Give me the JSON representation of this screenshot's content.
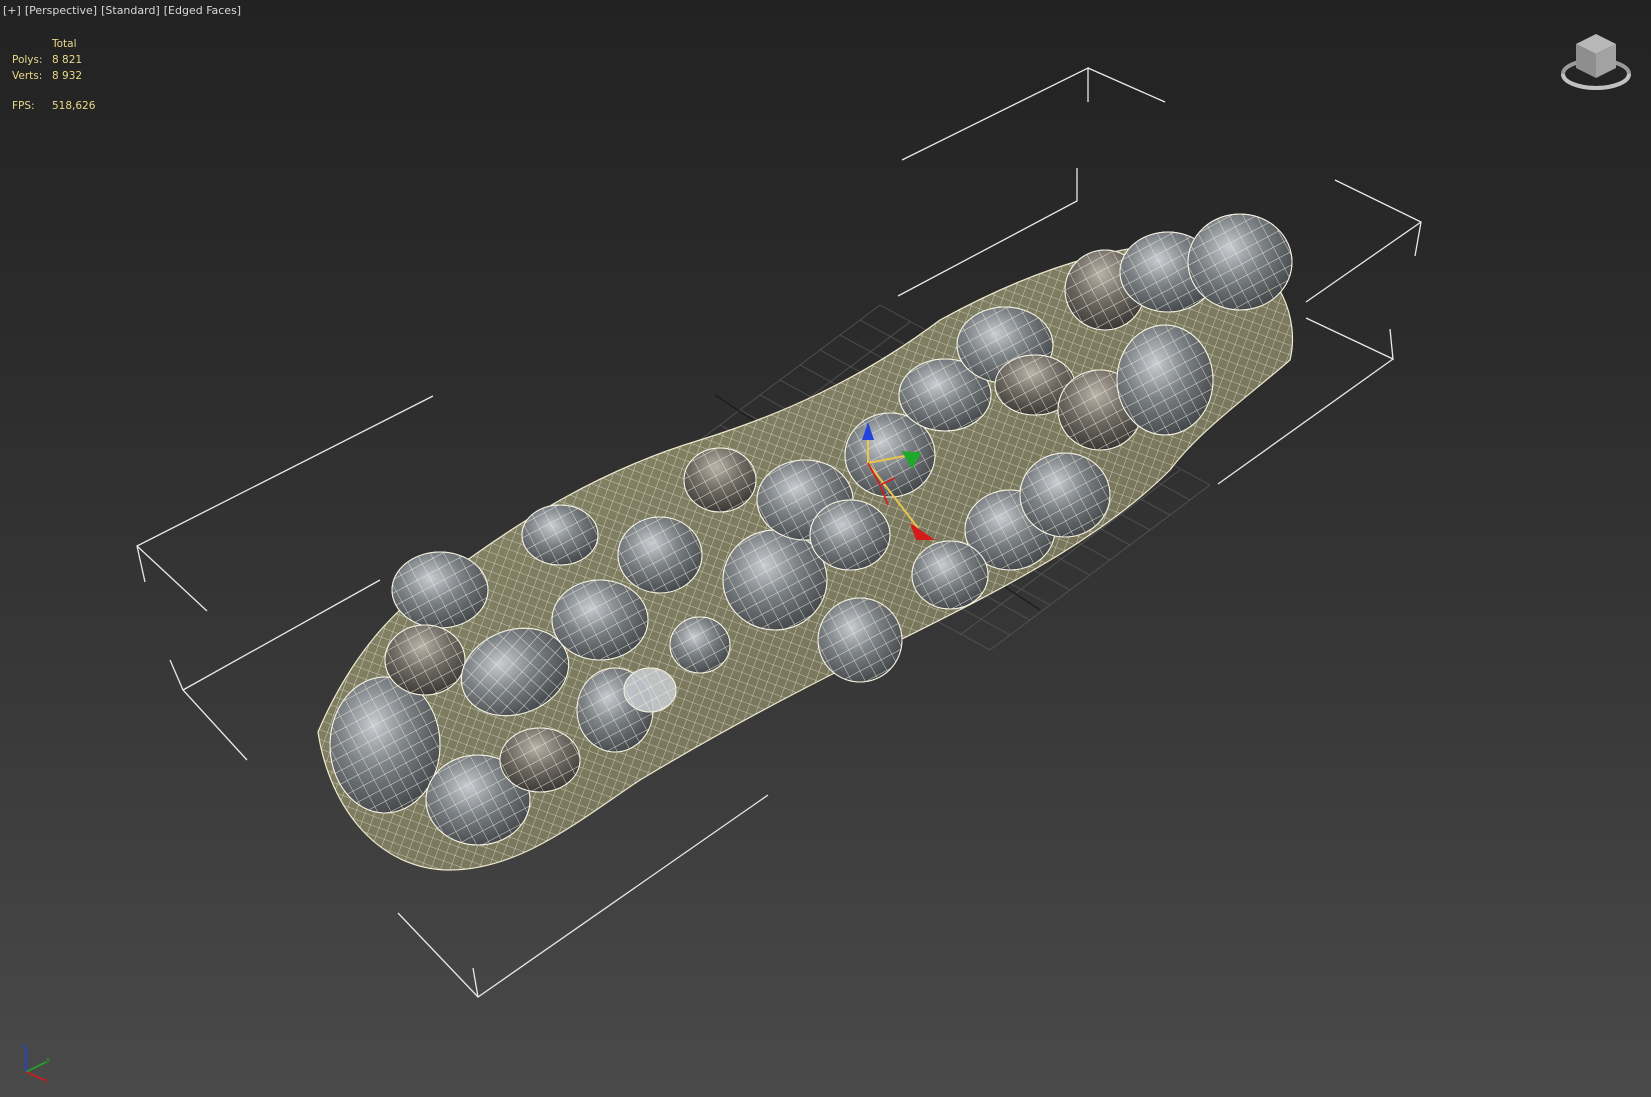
{
  "viewport": {
    "menu": {
      "plus": "[+]",
      "view": "[Perspective]",
      "shading": "[Standard]",
      "mode": "[Edged Faces]"
    },
    "stats": {
      "header": "Total",
      "polys_label": "Polys:",
      "polys_value": "8 821",
      "verts_label": "Verts:",
      "verts_value": "8 932",
      "fps_label": "FPS:",
      "fps_value": "518,626"
    },
    "icons": {
      "viewcube": "viewcube-icon",
      "gizmo": "move-gizmo-icon",
      "tripod": "axis-tripod-icon"
    },
    "colors": {
      "background_top": "#222222",
      "background_bottom": "#4a4a4a",
      "stats_text": "#e8d98a",
      "wireframe": "#f2efdf",
      "bbox": "#e8e8e8",
      "axis_x": "#d41a1a",
      "axis_y": "#1fa82a",
      "axis_z": "#2244dd"
    }
  }
}
